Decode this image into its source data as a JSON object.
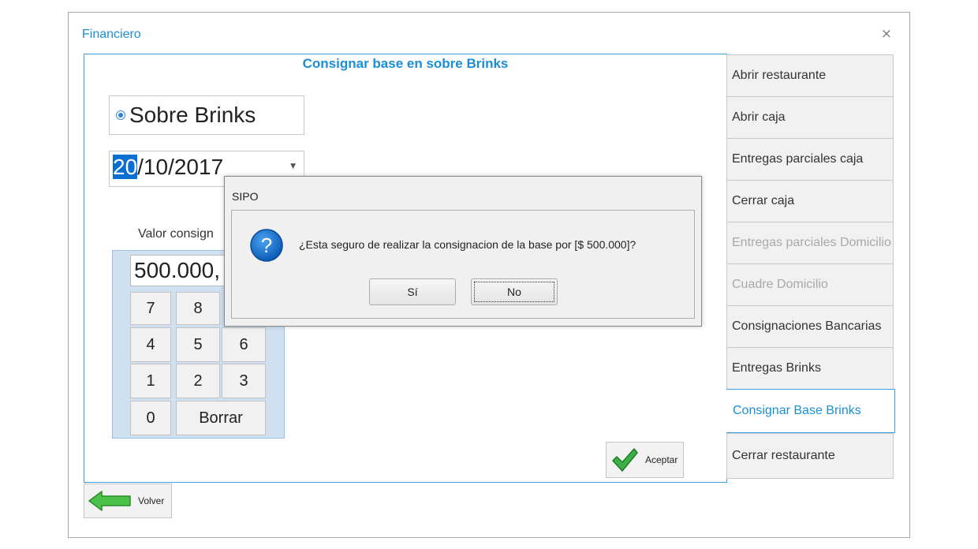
{
  "window": {
    "title": "Financiero",
    "close_glyph": "×"
  },
  "panel": {
    "title": "Consignar base en sobre Brinks",
    "radio_label": "Sobre Brinks",
    "date": {
      "day": "20",
      "rest": "/10/2017"
    },
    "valor_label": "Valor consign",
    "keypad": {
      "display": "500.000,",
      "keys": [
        "7",
        "8",
        "4",
        "5",
        "6",
        "1",
        "2",
        "3",
        "0",
        "Borrar"
      ]
    },
    "aceptar_label": "Aceptar"
  },
  "volver_label": "Volver",
  "menu": {
    "items": [
      "Abrir restaurante",
      "Abrir caja",
      "Entregas parciales caja",
      "Cerrar caja",
      "Entregas parciales Domicilio",
      "Cuadre Domicilio",
      "Consignaciones Bancarias",
      "Entregas Brinks",
      "Consignar Base Brinks",
      "Cerrar restaurante"
    ],
    "disabled_items": [
      "Entregas parciales Domicilio",
      "Cuadre Domicilio"
    ],
    "active_item": "Consignar Base Brinks"
  },
  "dialog": {
    "title": "SIPO",
    "icon": "question-icon",
    "message": "¿Esta seguro de realizar la consignacion de la base por [$ 500.000]?",
    "yes_label": "Sí",
    "no_label": "No"
  },
  "colors": {
    "accent": "#1a8fd8",
    "keypad_bg": "#cfe0f0",
    "selection": "#0a6fd0"
  }
}
